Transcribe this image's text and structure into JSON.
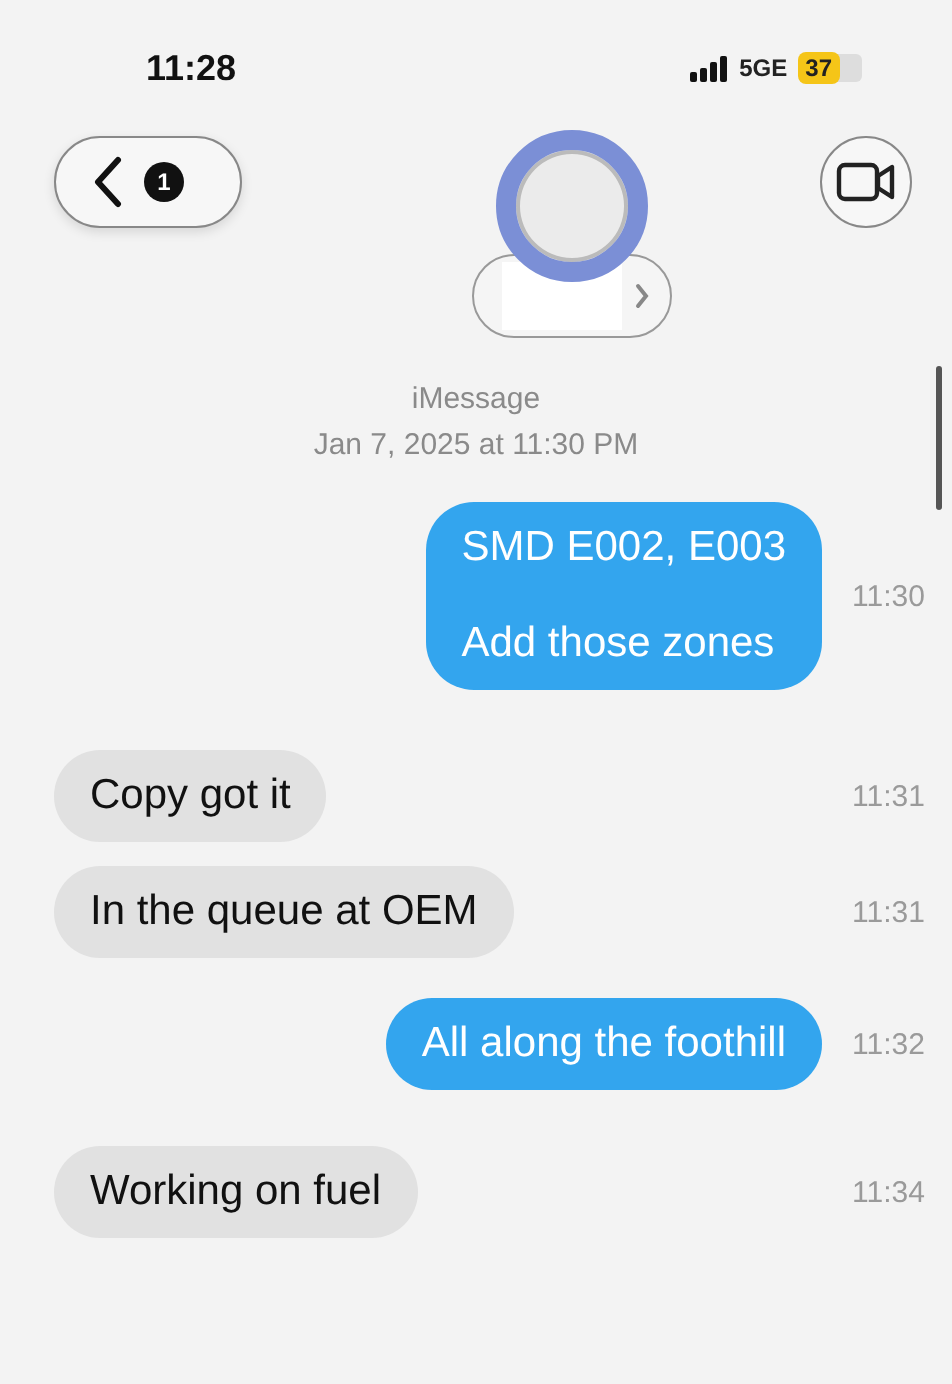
{
  "status_bar": {
    "time": "11:28",
    "network": "5GE",
    "battery": "37"
  },
  "header": {
    "badge": "1"
  },
  "service": "iMessage",
  "date": "Jan 7, 2025 at 11:30 PM",
  "messages": [
    {
      "kind": "outgoing",
      "lines": [
        "SMD E002, E003",
        "Add those zones"
      ],
      "time": "11:30"
    },
    {
      "kind": "incoming",
      "lines": [
        "Copy got it"
      ],
      "time": "11:31"
    },
    {
      "kind": "incoming",
      "lines": [
        "In the queue at OEM"
      ],
      "time": "11:31"
    },
    {
      "kind": "outgoing",
      "lines": [
        "All along the foothill"
      ],
      "time": "11:32"
    },
    {
      "kind": "incoming",
      "lines": [
        "Working on fuel"
      ],
      "time": "11:34"
    }
  ]
}
